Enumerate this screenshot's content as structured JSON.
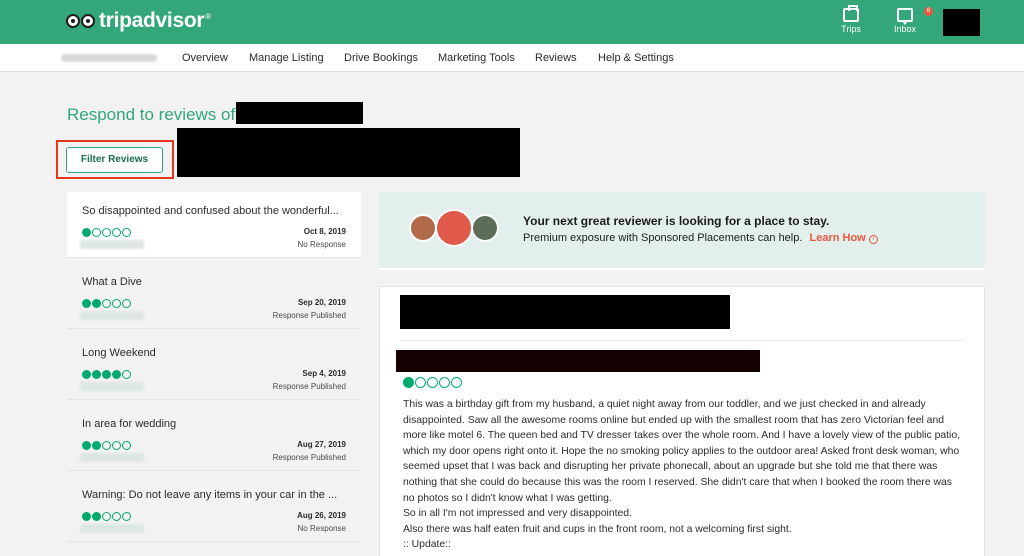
{
  "header": {
    "logo_text": "tripadvisor",
    "logo_reg": "®",
    "trips_label": "Trips",
    "inbox_label": "Inbox",
    "inbox_badge": "6"
  },
  "nav": {
    "items": [
      "Overview",
      "Manage Listing",
      "Drive Bookings",
      "Marketing Tools",
      "Reviews",
      "Help & Settings"
    ]
  },
  "page": {
    "title": "Respond to reviews of",
    "filter_button": "Filter Reviews"
  },
  "reviews": [
    {
      "title": "So disappointed and confused about the wonderful...",
      "rating": 1,
      "date": "Oct 8, 2019",
      "status": "No Response"
    },
    {
      "title": "What a Dive",
      "rating": 2,
      "date": "Sep 20, 2019",
      "status": "Response Published"
    },
    {
      "title": "Long Weekend",
      "rating": 4,
      "date": "Sep 4, 2019",
      "status": "Response Published"
    },
    {
      "title": "In area for wedding",
      "rating": 2,
      "date": "Aug 27, 2019",
      "status": "Response Published"
    },
    {
      "title": "Warning: Do not leave any items in your car in the ...",
      "rating": 2,
      "date": "Aug 26, 2019",
      "status": "No Response"
    }
  ],
  "promo": {
    "title": "Your next great reviewer is looking for a place to stay.",
    "subtitle": "Premium exposure with Sponsored Placements can help.",
    "link": "Learn How"
  },
  "detail": {
    "rating": 1,
    "body": "This was a birthday gift from my husband, a quiet night away from our toddler, and we just checked in and already\ndisappointed. Saw all the awesome rooms online but ended up with the smallest room that has zero Victorian feel and\nmore like motel 6. The queen bed and TV dresser takes over the whole room. And I have a lovely view of the public patio,\nwhich my door opens right onto it. Hope the no smoking policy applies to the outdoor area! Asked front desk woman, who\nseemed upset that I was back and disrupting her private phonecall, about an upgrade but she told me that there was\nnothing that she could do because this was the room I reserved. She didn't care that when I booked the room there was\nno photos so I didn't know what I was getting.\nSo in all I'm not impressed and very disappointed.\nAlso there was half eaten fruit and cups in the front room, not a welcoming first sight.\n:: Update::"
  },
  "colors": {
    "brand_green": "#34a77a",
    "bubble_green": "#00aa6c",
    "highlight_red": "#e1381f",
    "link_orange": "#e8583d"
  }
}
